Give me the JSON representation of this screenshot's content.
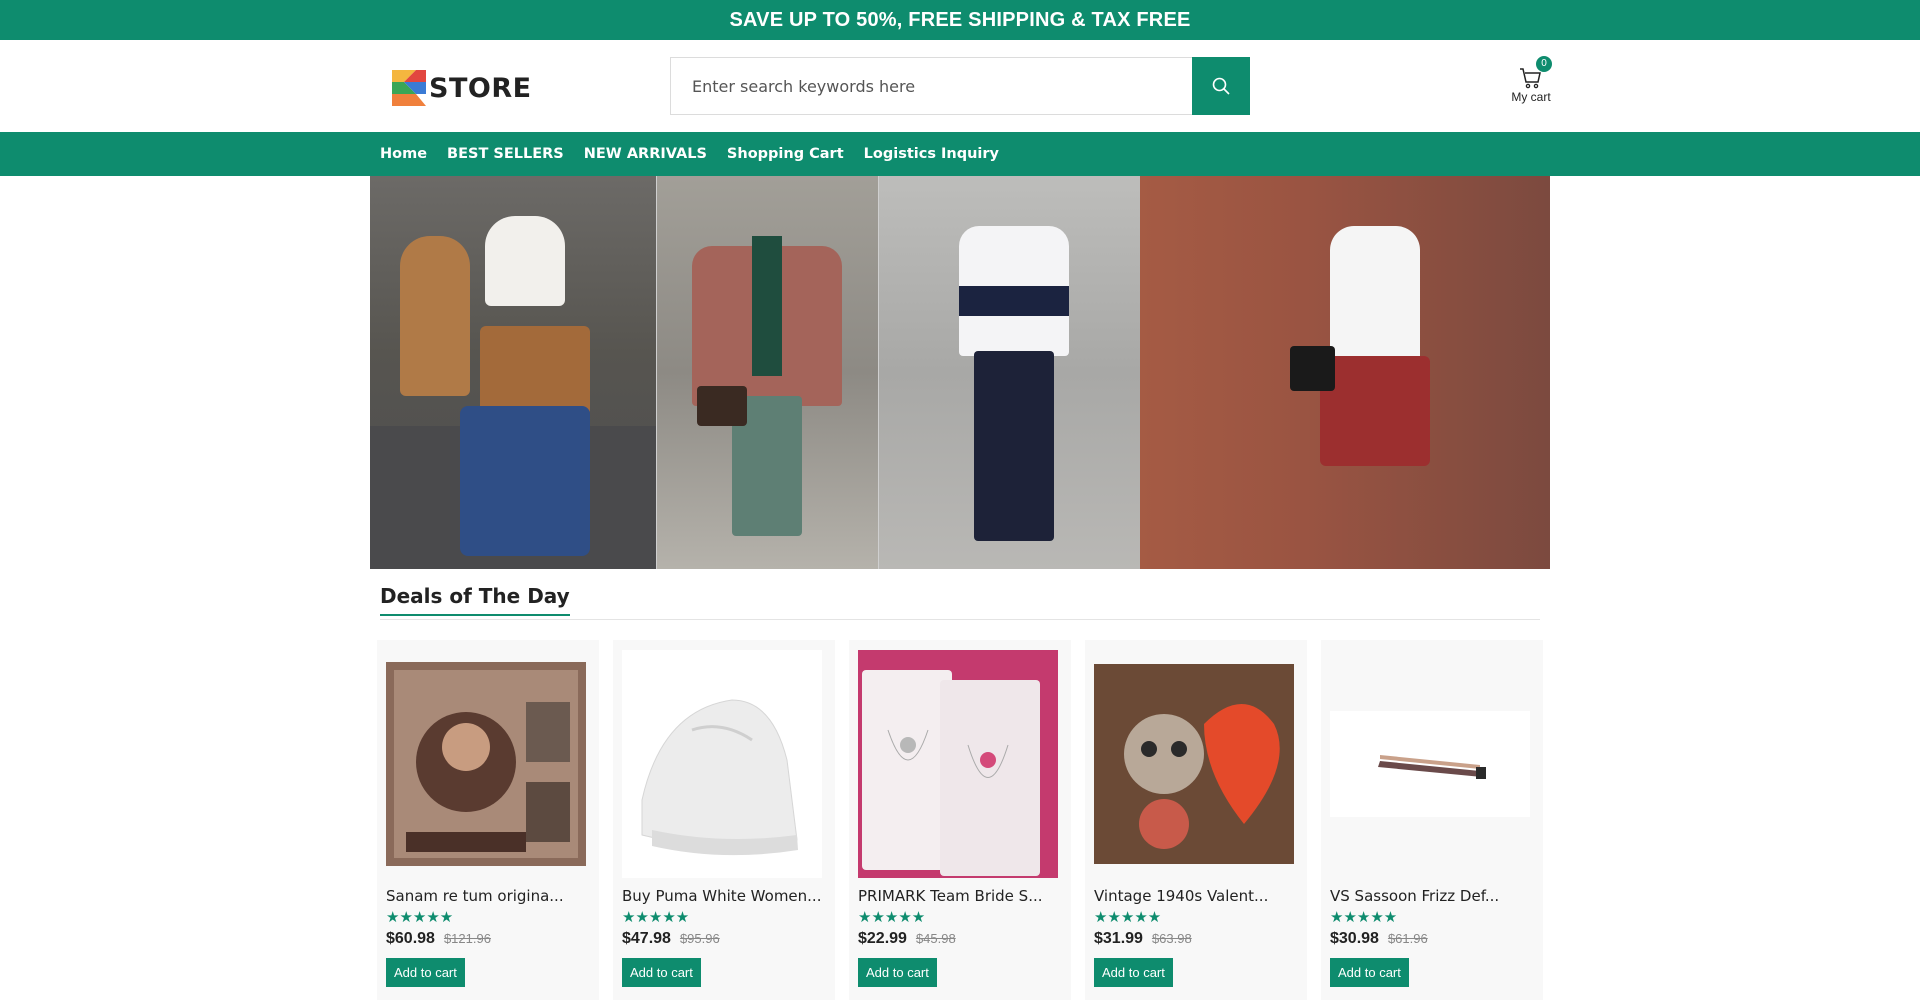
{
  "promo_banner": "SAVE UP TO 50%, FREE SHIPPING & TAX FREE",
  "logo_text": "STORE",
  "search": {
    "placeholder": "Enter search keywords here"
  },
  "cart": {
    "count": "0",
    "label": "My cart"
  },
  "nav": [
    "Home",
    "BEST SELLERS",
    "NEW ARRIVALS",
    "Shopping Cart",
    "Logistics Inquiry"
  ],
  "section_title": "Deals of The Day",
  "products": [
    {
      "name": "Sanam re tum origina...",
      "stars": "★★★★★",
      "price": "$60.98",
      "old_price": "$121.96",
      "button": "Add to cart"
    },
    {
      "name": "Buy Puma White Women...",
      "stars": "★★★★★",
      "price": "$47.98",
      "old_price": "$95.96",
      "button": "Add to cart"
    },
    {
      "name": "PRIMARK Team Bride S...",
      "stars": "★★★★★",
      "price": "$22.99",
      "old_price": "$45.98",
      "button": "Add to cart"
    },
    {
      "name": "Vintage 1940s Valent...",
      "stars": "★★★★★",
      "price": "$31.99",
      "old_price": "$63.98",
      "button": "Add to cart"
    },
    {
      "name": "VS Sassoon Frizz Def...",
      "stars": "★★★★★",
      "price": "$30.98",
      "old_price": "$61.96",
      "button": "Add to cart"
    }
  ],
  "colors": {
    "accent": "#0e8c6e"
  }
}
